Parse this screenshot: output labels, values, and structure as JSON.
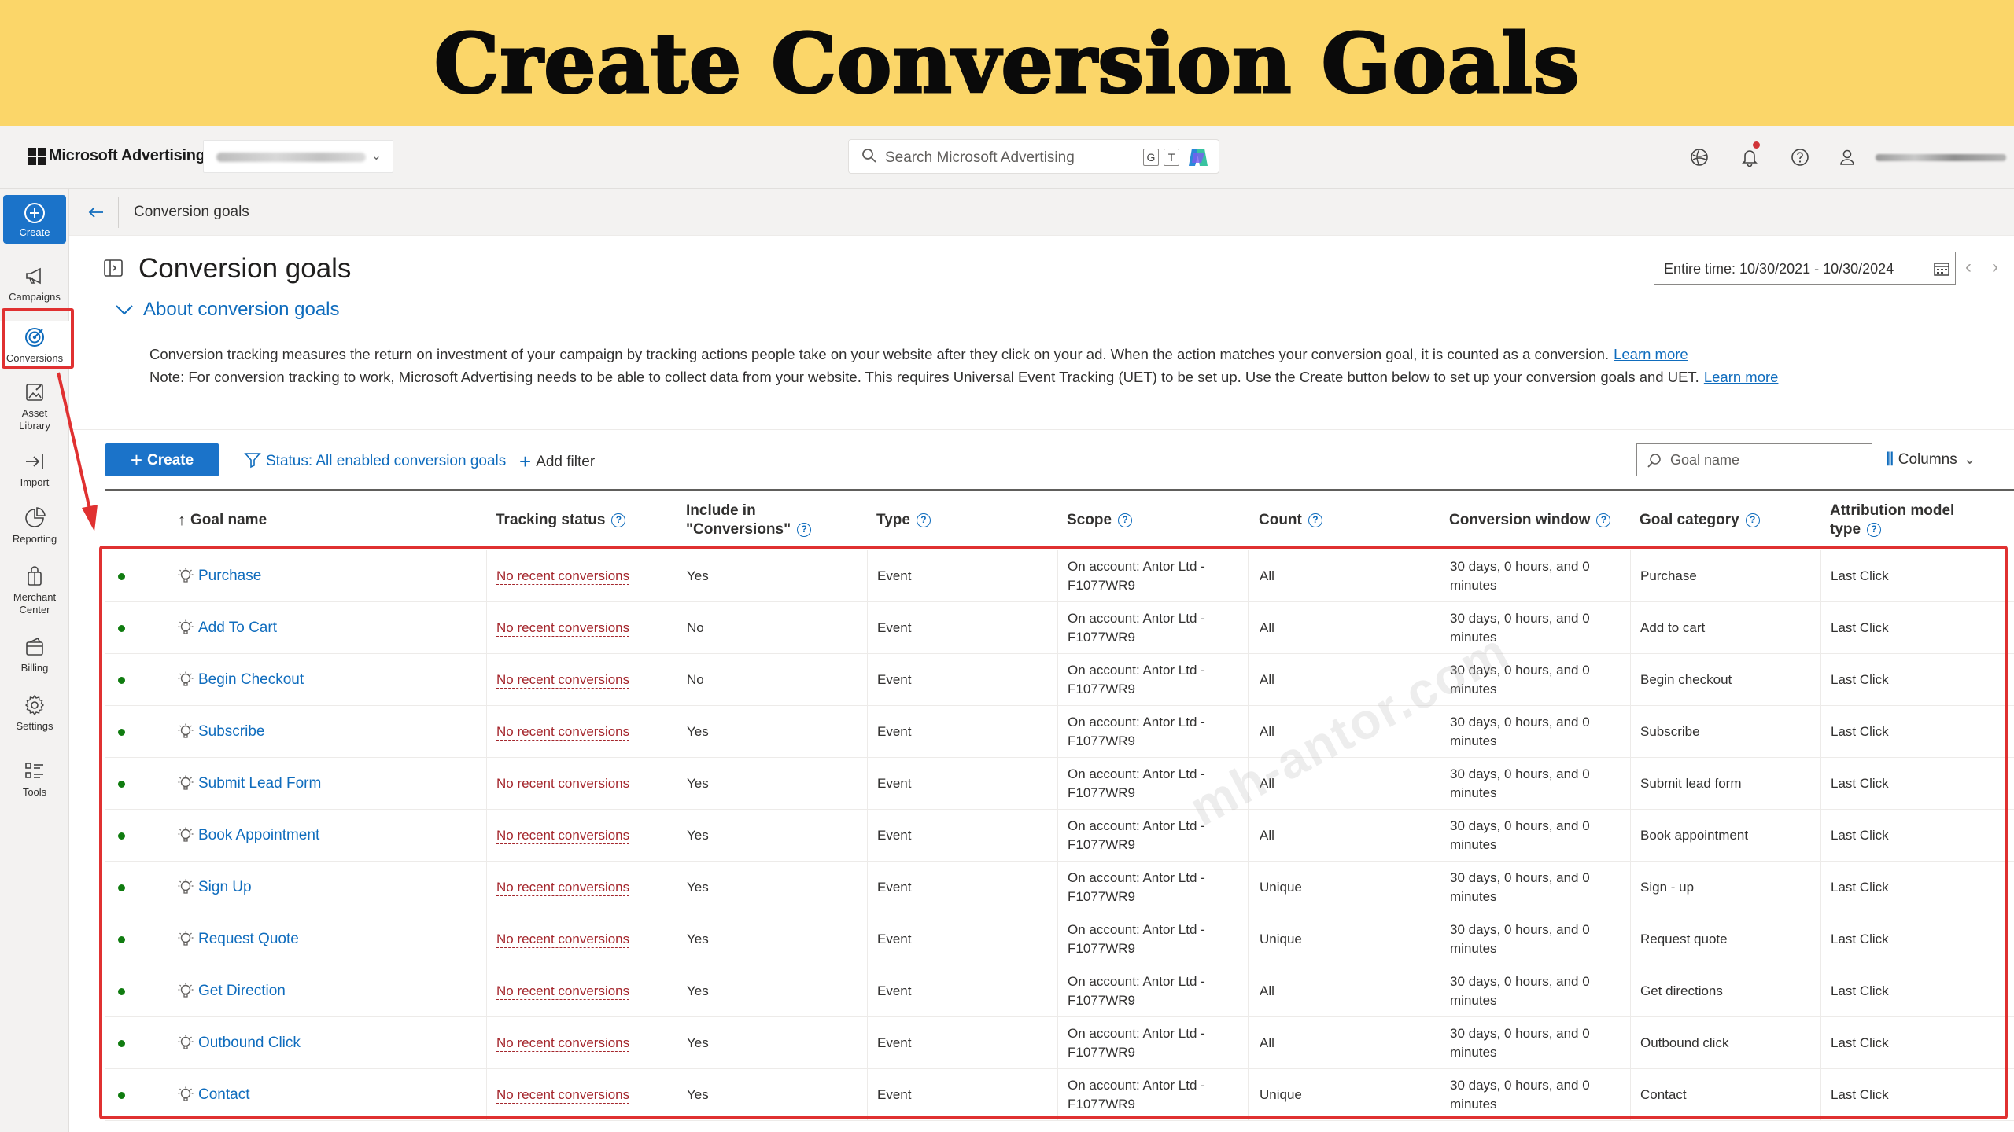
{
  "banner": {
    "title": "Create Conversion Goals"
  },
  "topbar": {
    "brand": "Microsoft Advertising",
    "search_placeholder": "Search Microsoft Advertising",
    "kbd_g": "G",
    "kbd_t": "T"
  },
  "rail": {
    "create": "Create",
    "items": [
      {
        "label": "Campaigns",
        "icon": "megaphone-icon"
      },
      {
        "label": "Conversions",
        "icon": "target-icon"
      },
      {
        "label": "Asset Library",
        "icon": "asset-library-icon"
      },
      {
        "label": "Import",
        "icon": "import-icon"
      },
      {
        "label": "Reporting",
        "icon": "reporting-icon"
      },
      {
        "label": "Merchant Center",
        "icon": "merchant-icon"
      },
      {
        "label": "Billing",
        "icon": "billing-icon"
      },
      {
        "label": "Settings",
        "icon": "gear-icon"
      },
      {
        "label": "Tools",
        "icon": "tools-icon"
      }
    ]
  },
  "breadcrumb": {
    "current": "Conversion goals"
  },
  "page": {
    "title": "Conversion goals",
    "date_range": "Entire time: 10/30/2021 - 10/30/2024",
    "about_title": "About conversion goals",
    "about_text_1": "Conversion tracking measures the return on investment of your campaign by tracking actions people take on your website after they click on your ad. When the action matches your conversion goal, it is counted as a conversion.",
    "about_text_2": "Note: For conversion tracking to work, Microsoft Advertising needs to be able to collect data from your website. This requires Universal Event Tracking (UET) to be set up. Use the Create button below to set up your conversion goals and UET.",
    "learn_more": "Learn more"
  },
  "toolbar": {
    "create_label": "Create",
    "filter_status": "Status: All enabled conversion goals",
    "add_filter": "Add filter",
    "search_placeholder": "Goal name",
    "columns_label": "Columns"
  },
  "table": {
    "headers": {
      "goal_name": "Goal name",
      "tracking_status": "Tracking status",
      "include_line1": "Include in",
      "include_line2": "\"Conversions\"",
      "type": "Type",
      "scope": "Scope",
      "count": "Count",
      "conversion_window": "Conversion window",
      "goal_category": "Goal category",
      "attribution_line1": "Attribution model",
      "attribution_line2": "type"
    },
    "rows": [
      {
        "goal": "Purchase",
        "tracking": "No recent conversions",
        "include": "Yes",
        "type": "Event",
        "scope": "On account: Antor Ltd - F1077WR9",
        "count": "All",
        "window": "30 days, 0 hours, and 0 minutes",
        "category": "Purchase",
        "attribution": "Last Click"
      },
      {
        "goal": "Add To Cart",
        "tracking": "No recent conversions",
        "include": "No",
        "type": "Event",
        "scope": "On account: Antor Ltd - F1077WR9",
        "count": "All",
        "window": "30 days, 0 hours, and 0 minutes",
        "category": "Add to cart",
        "attribution": "Last Click"
      },
      {
        "goal": "Begin Checkout",
        "tracking": "No recent conversions",
        "include": "No",
        "type": "Event",
        "scope": "On account: Antor Ltd - F1077WR9",
        "count": "All",
        "window": "30 days, 0 hours, and 0 minutes",
        "category": "Begin checkout",
        "attribution": "Last Click"
      },
      {
        "goal": "Subscribe",
        "tracking": "No recent conversions",
        "include": "Yes",
        "type": "Event",
        "scope": "On account: Antor Ltd - F1077WR9",
        "count": "All",
        "window": "30 days, 0 hours, and 0 minutes",
        "category": "Subscribe",
        "attribution": "Last Click"
      },
      {
        "goal": "Submit Lead Form",
        "tracking": "No recent conversions",
        "include": "Yes",
        "type": "Event",
        "scope": "On account: Antor Ltd - F1077WR9",
        "count": "All",
        "window": "30 days, 0 hours, and 0 minutes",
        "category": "Submit lead form",
        "attribution": "Last Click"
      },
      {
        "goal": "Book Appointment",
        "tracking": "No recent conversions",
        "include": "Yes",
        "type": "Event",
        "scope": "On account: Antor Ltd - F1077WR9",
        "count": "All",
        "window": "30 days, 0 hours, and 0 minutes",
        "category": "Book appointment",
        "attribution": "Last Click"
      },
      {
        "goal": "Sign Up",
        "tracking": "No recent conversions",
        "include": "Yes",
        "type": "Event",
        "scope": "On account: Antor Ltd - F1077WR9",
        "count": "Unique",
        "window": "30 days, 0 hours, and 0 minutes",
        "category": "Sign - up",
        "attribution": "Last Click"
      },
      {
        "goal": "Request Quote",
        "tracking": "No recent conversions",
        "include": "Yes",
        "type": "Event",
        "scope": "On account: Antor Ltd - F1077WR9",
        "count": "Unique",
        "window": "30 days, 0 hours, and 0 minutes",
        "category": "Request quote",
        "attribution": "Last Click"
      },
      {
        "goal": "Get Direction",
        "tracking": "No recent conversions",
        "include": "Yes",
        "type": "Event",
        "scope": "On account: Antor Ltd - F1077WR9",
        "count": "All",
        "window": "30 days, 0 hours, and 0 minutes",
        "category": "Get directions",
        "attribution": "Last Click"
      },
      {
        "goal": "Outbound Click",
        "tracking": "No recent conversions",
        "include": "Yes",
        "type": "Event",
        "scope": "On account: Antor Ltd - F1077WR9",
        "count": "All",
        "window": "30 days, 0 hours, and 0 minutes",
        "category": "Outbound click",
        "attribution": "Last Click"
      },
      {
        "goal": "Contact",
        "tracking": "No recent conversions",
        "include": "Yes",
        "type": "Event",
        "scope": "On account: Antor Ltd - F1077WR9",
        "count": "Unique",
        "window": "30 days, 0 hours, and 0 minutes",
        "category": "Contact",
        "attribution": "Last Click"
      }
    ]
  },
  "watermark": "mh-antor.com",
  "colors": {
    "banner": "#fbd669",
    "accent": "#0f6cbd",
    "create_button": "#1b73c9",
    "annotation": "#e03131",
    "status_dot": "#107c10",
    "tracking_text": "#a4262c"
  }
}
